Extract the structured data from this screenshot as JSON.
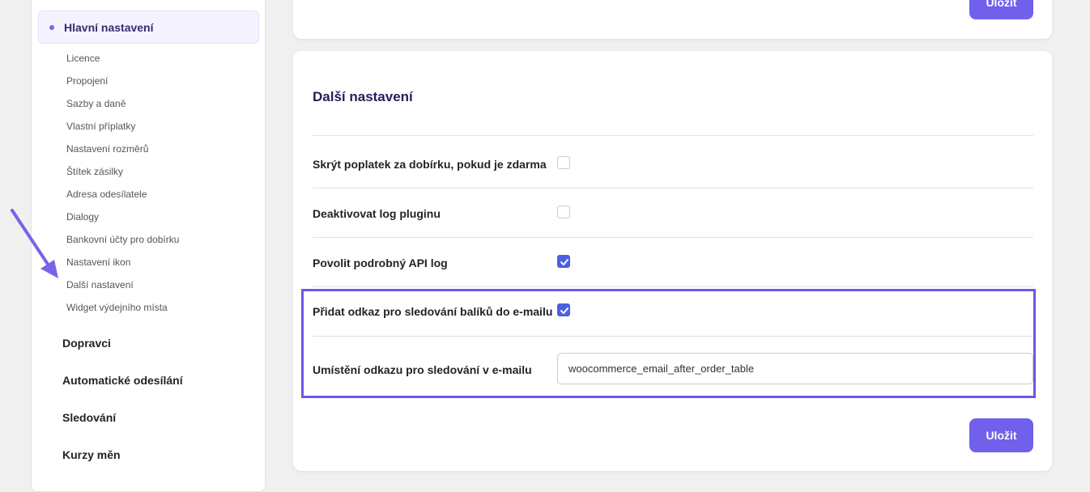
{
  "sidebar": {
    "active_label": "Hlavní nastavení",
    "sub_items": [
      "Licence",
      "Propojení",
      "Sazby a daně",
      "Vlastní příplatky",
      "Nastavení rozměrů",
      "Štítek zásilky",
      "Adresa odesílatele",
      "Dialogy",
      "Bankovní účty pro dobírku",
      "Nastavení ikon",
      "Další nastavení",
      "Widget výdejního místa"
    ],
    "sections": [
      "Dopravci",
      "Automatické odesílání",
      "Sledování",
      "Kurzy měn"
    ]
  },
  "top_card": {
    "save_label": "Uložit"
  },
  "main_card": {
    "title": "Další nastavení",
    "rows": [
      {
        "label": "Skrýt poplatek za dobírku, pokud je zdarma",
        "checked": false
      },
      {
        "label": "Deaktivovat log pluginu",
        "checked": false
      },
      {
        "label": "Povolit podrobný API log",
        "checked": true
      },
      {
        "label": "Přidat odkaz pro sledování balíků do e-mailu",
        "checked": true
      }
    ],
    "location_label": "Umístění odkazu pro sledování v e-mailu",
    "location_value": "woocommerce_email_after_order_table",
    "save_label": "Uložit"
  },
  "colors": {
    "accent": "#7060ec",
    "checkbox_checked": "#4a5fe6",
    "highlight_border": "#6f57e8",
    "annotation_arrow": "#7a63e8"
  }
}
